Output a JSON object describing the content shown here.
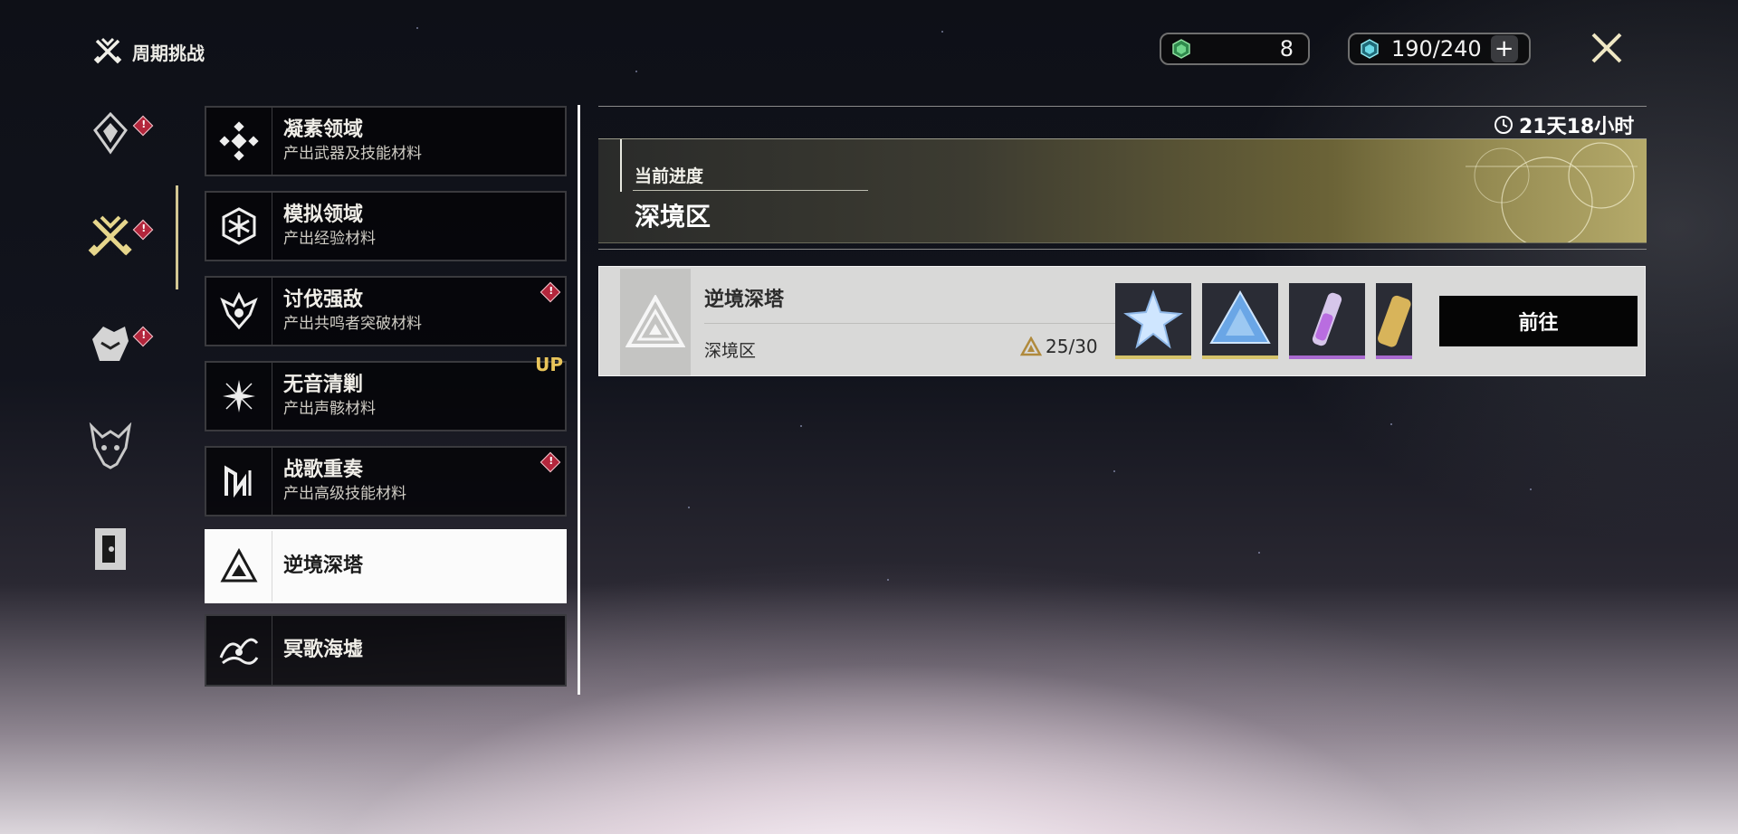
{
  "header": {
    "title": "周期挑战",
    "resource_1_value": "8",
    "resource_2_value": "190/240",
    "plus_label": "+"
  },
  "colors": {
    "accent_gold": "#d2c693",
    "alert_red": "#b3263c",
    "up_badge": "#e8c45a",
    "reward_gold": "#d6c46b",
    "reward_purple": "#a96ad0"
  },
  "rail": {
    "items": [
      {
        "icon": "crystal-icon",
        "alert": true
      },
      {
        "icon": "crossed-swords-icon",
        "alert": true,
        "active": true
      },
      {
        "icon": "beast-icon",
        "alert": true
      },
      {
        "icon": "dragon-head-icon",
        "alert": false
      },
      {
        "icon": "door-icon",
        "alert": false
      }
    ]
  },
  "list": {
    "items": [
      {
        "name": "凝素领域",
        "sub": "产出武器及技能材料",
        "icon": "diamond-cross-icon"
      },
      {
        "name": "模拟领域",
        "sub": "产出经验材料",
        "icon": "hexagon-icon"
      },
      {
        "name": "讨伐强敌",
        "sub": "产出共鸣者突破材料",
        "icon": "flame-crest-icon",
        "alert": true
      },
      {
        "name": "无音清剿",
        "sub": "产出声骸材料",
        "icon": "sparkle-icon",
        "badge": "UP"
      },
      {
        "name": "战歌重奏",
        "sub": "产出高级技能材料",
        "icon": "harp-icon",
        "alert": true
      },
      {
        "name": "逆境深塔",
        "sub": "",
        "icon": "triangle-icon",
        "active": true
      },
      {
        "name": "冥歌海墟",
        "sub": "",
        "icon": "wave-bird-icon"
      }
    ]
  },
  "timer": "21天18小时",
  "banner": {
    "sub": "当前进度",
    "main": "深境区"
  },
  "entry": {
    "title": "逆境深塔",
    "zone": "深境区",
    "progress": "25/30",
    "go_label": "前往",
    "rewards": [
      {
        "icon": "star-crystal-icon",
        "rarity": "gold"
      },
      {
        "icon": "blue-prism-icon",
        "rarity": "gold"
      },
      {
        "icon": "purple-vial-icon",
        "rarity": "purple"
      },
      {
        "icon": "gold-tube-icon",
        "rarity": "purple"
      }
    ]
  }
}
